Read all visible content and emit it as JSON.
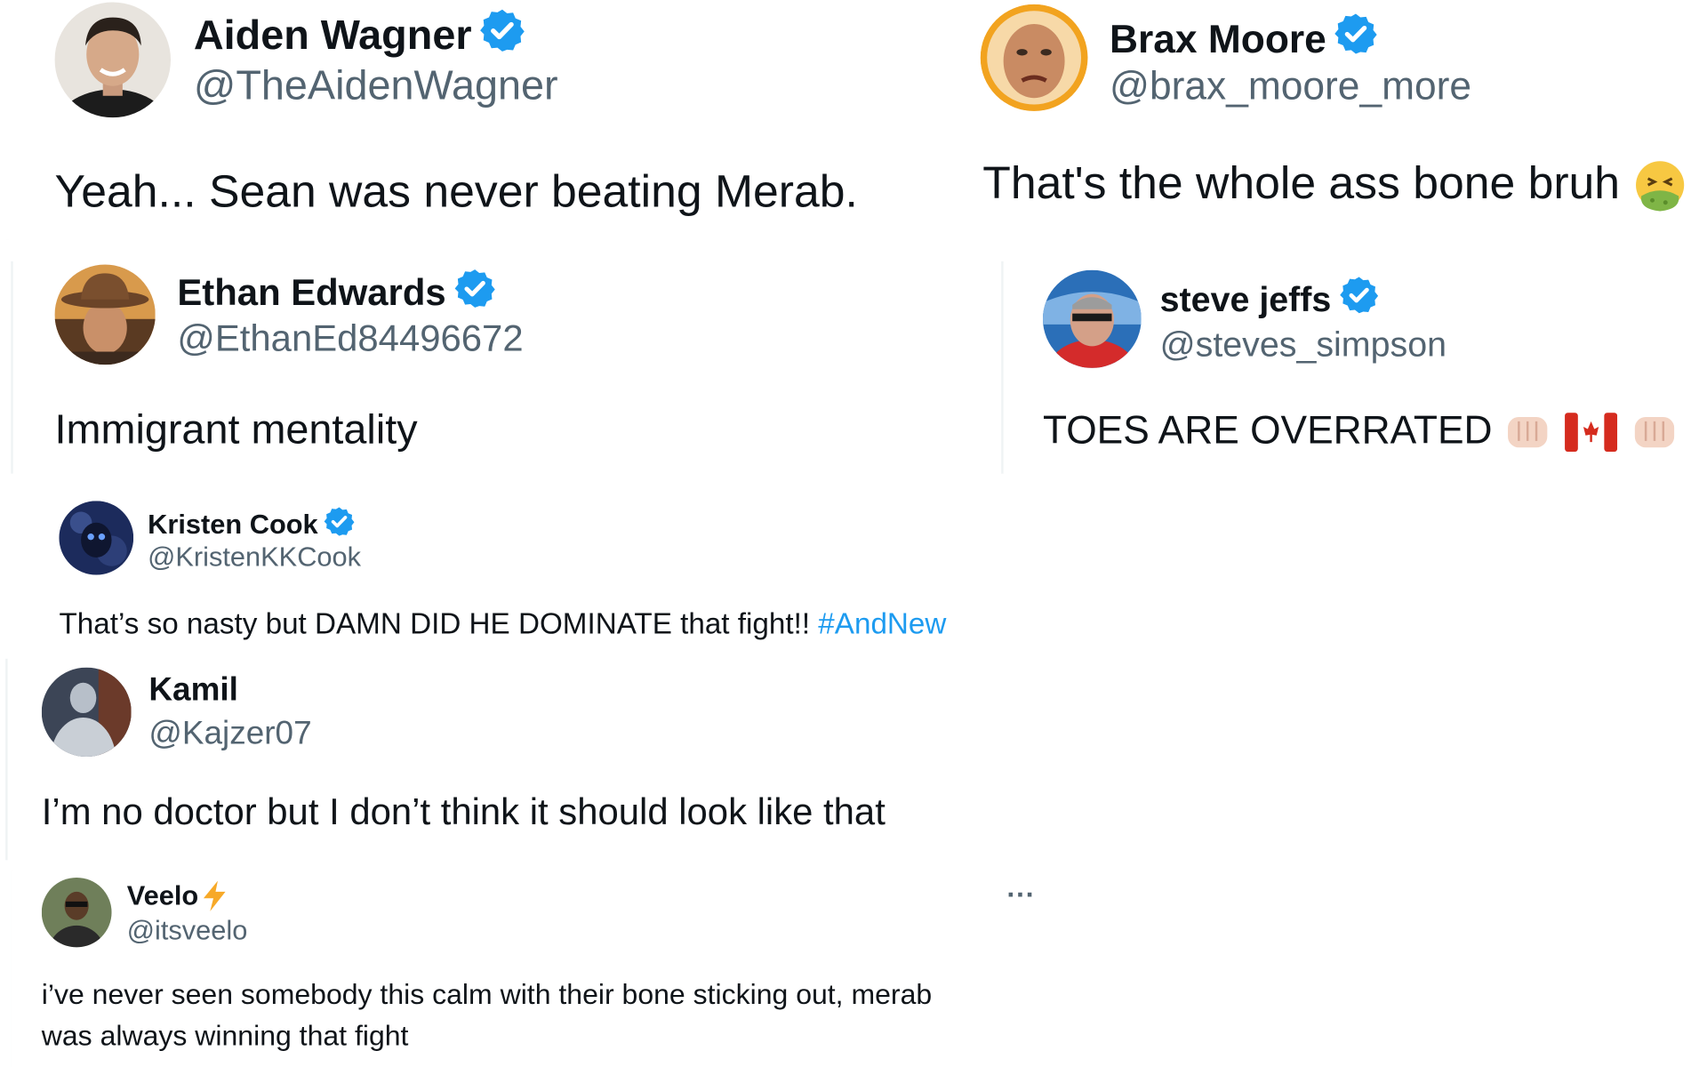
{
  "colors": {
    "verified": "#1d9bf0",
    "hashtag": "#1d9bf0",
    "handle": "#536471",
    "text": "#0f1419"
  },
  "tweets": [
    {
      "name": "Aiden Wagner",
      "handle": "@TheAidenWagner",
      "verified": true,
      "text": "Yeah... Sean was never beating Merab."
    },
    {
      "name": "Brax Moore",
      "handle": "@brax_moore_more",
      "verified": true,
      "text": "That's the whole ass bone bruh",
      "emoji": "nauseated-face-icon"
    },
    {
      "name": "Ethan Edwards",
      "handle": "@EthanEd84496672",
      "verified": true,
      "text": "Immigrant mentality"
    },
    {
      "name": "steve jeffs",
      "handle": "@steves_simpson",
      "verified": true,
      "text": "TOES ARE OVERRATED",
      "emoji": [
        "fist-icon",
        "canada-flag-icon",
        "fist-icon"
      ]
    },
    {
      "name": "Kristen Cook",
      "handle": "@KristenKKCook",
      "verified": true,
      "text": "That’s so nasty but DAMN DID HE DOMINATE that fight!!",
      "hashtag": "#AndNew"
    },
    {
      "name": "Kamil",
      "handle": "@Kajzer07",
      "verified": false,
      "text": "I’m no doctor but I don’t think it should look like that"
    },
    {
      "name": "Veelo",
      "handle": "@itsveelo",
      "verified": false,
      "name_emoji": "lightning-icon",
      "more": "···",
      "text_lines": [
        "i’ve never seen somebody this calm with their bone sticking out, merab",
        "was always winning that fight"
      ]
    }
  ]
}
